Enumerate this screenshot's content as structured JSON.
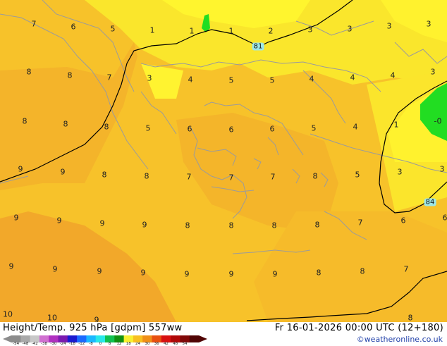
{
  "header": {
    "title": "Height/Temp. 925 hPa [gdpm] 557ww",
    "datetime": "Fr 16-01-2026 00:00 UTC (12+180)",
    "credit": "©weatheronline.co.uk"
  },
  "colors": {
    "field_base": "#f7c22a",
    "field_warm": "#f4ae2a",
    "field_light": "#fae82c",
    "field_yellow": "#fff52e",
    "green": "#22dd22",
    "isoline": "#000000",
    "coast": "#9b9b9b",
    "badge": "#9ee8e8"
  },
  "map": {
    "badges": [
      "81",
      "84"
    ],
    "labels": [
      "7",
      "6",
      "5",
      "1",
      "1",
      "1",
      "2",
      "3",
      "3",
      "3",
      "3",
      "8",
      "8",
      "7",
      "3",
      "4",
      "5",
      "5",
      "4",
      "4",
      "4",
      "3",
      "8",
      "8",
      "8",
      "5",
      "6",
      "6",
      "6",
      "5",
      "4",
      "1",
      "-0",
      "9",
      "9",
      "8",
      "8",
      "7",
      "7",
      "7",
      "8",
      "5",
      "3",
      "3",
      "9",
      "9",
      "9",
      "9",
      "8",
      "8",
      "8",
      "8",
      "7",
      "6",
      "6",
      "9",
      "9",
      "9",
      "9",
      "9",
      "9",
      "9",
      "8",
      "8",
      "7",
      "10",
      "10",
      "9",
      "8"
    ]
  },
  "scale": {
    "ticks": [
      "-54",
      "-48",
      "-42",
      "-38",
      "-30",
      "-24",
      "-18",
      "-12",
      "-8",
      "0",
      "8",
      "12",
      "18",
      "24",
      "30",
      "36",
      "42",
      "48",
      "54"
    ],
    "colors": [
      "#8c8c8c",
      "#a9a9a9",
      "#c8c8c8",
      "#d070d0",
      "#b030c0",
      "#7a1ab0",
      "#1a1ad0",
      "#1a6aff",
      "#1ab8ff",
      "#28e8e8",
      "#10c050",
      "#109010",
      "#f8f030",
      "#f8c020",
      "#f09018",
      "#e85010",
      "#d81010",
      "#b00808",
      "#800808",
      "#500404"
    ]
  }
}
